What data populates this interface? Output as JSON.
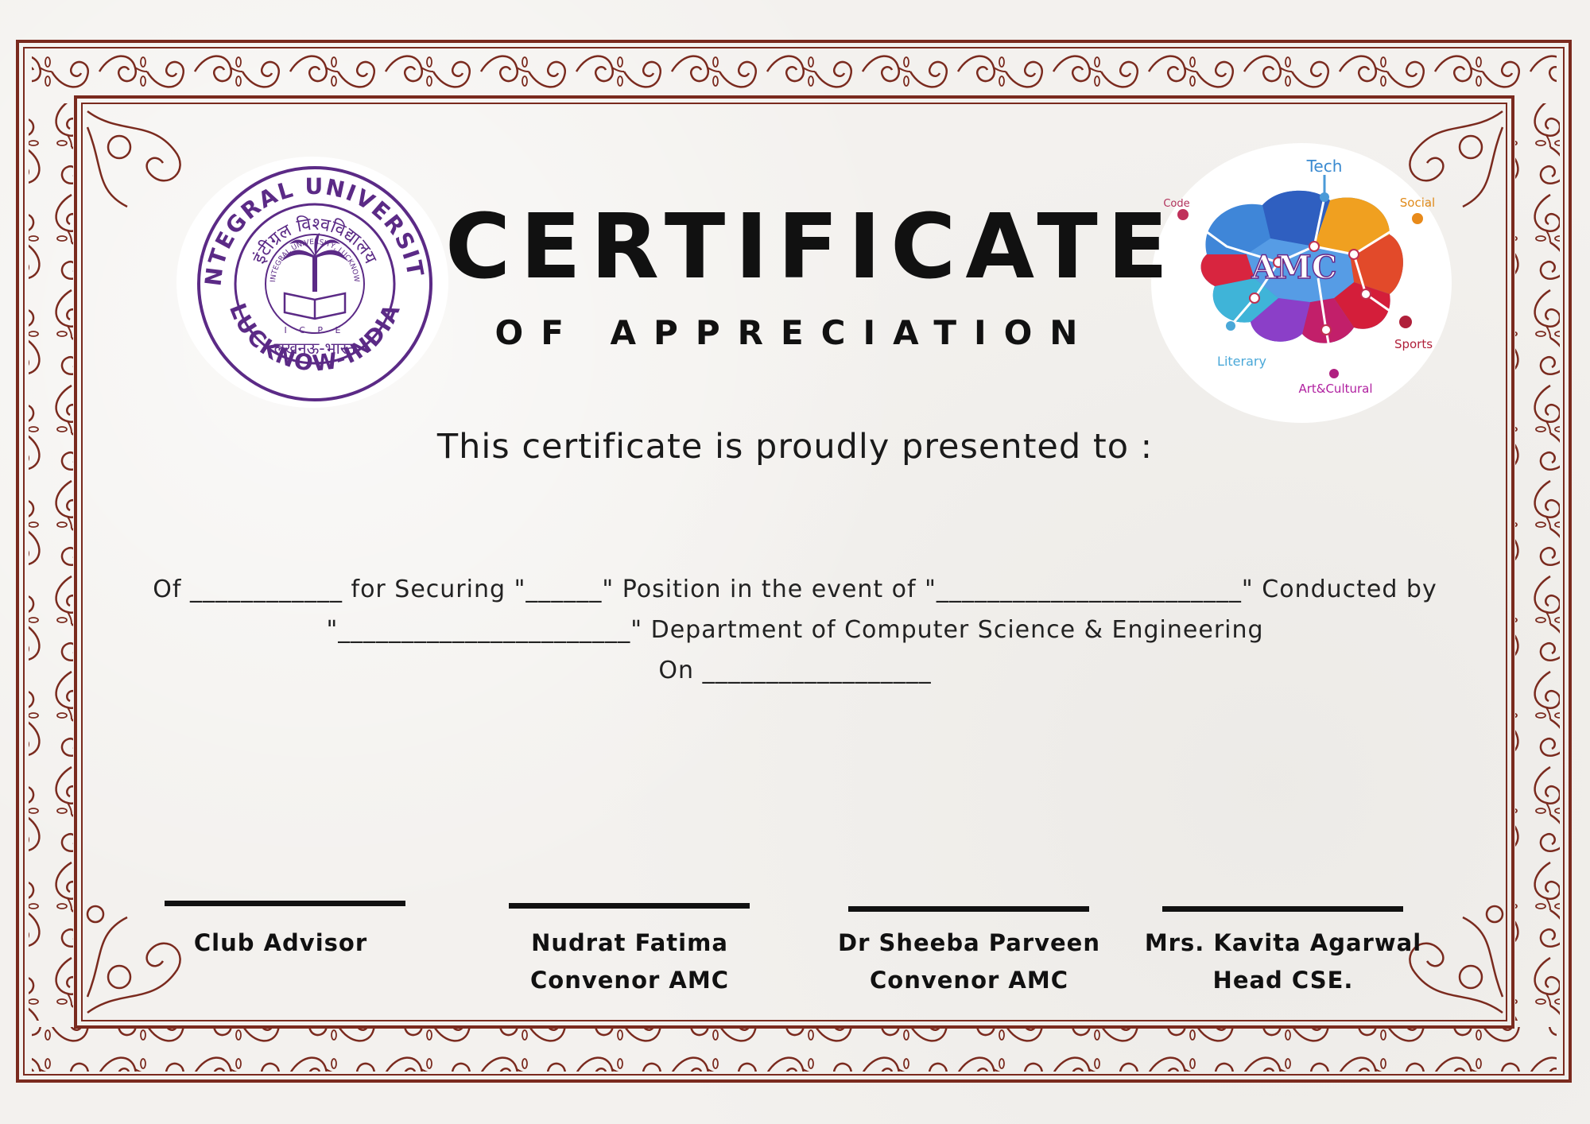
{
  "colors": {
    "border": "#7a2a1e",
    "seal_purple": "#5b2a86",
    "ink": "#111111"
  },
  "logos": {
    "left": {
      "name": "Integral University seal",
      "ring_top": "INTEGRAL UNIVERSITY",
      "ring_bottom": "LUCKNOW-INDIA",
      "hindi_top": "इंटीग्रल विश्वविद्यालय",
      "hindi_bottom": "लखनऊ-भारत",
      "inner_ring": "INTEGRAL UNIVERSITY, LUCKNOW",
      "inner_letters": "I C P E"
    },
    "right": {
      "name": "AMC club logo",
      "center": "AMC",
      "labels": [
        "Tech",
        "Social",
        "Code",
        "Sports",
        "Literary",
        "Art&Cultural"
      ]
    }
  },
  "certificate": {
    "title": "CERTIFICATE",
    "subtitle": "OF APPRECIATION",
    "presented": "This certificate is proudly presented to :",
    "line1": "Of ____________ for Securing \"______\" Position in the event of \"________________________\" Conducted by",
    "line2": "\"_______________________\" Department of Computer Science & Engineering",
    "line3": "On __________________"
  },
  "signatories": [
    {
      "name": "Club Advisor",
      "role": ""
    },
    {
      "name": "Nudrat Fatima",
      "role": "Convenor AMC"
    },
    {
      "name": "Dr Sheeba Parveen",
      "role": "Convenor AMC"
    },
    {
      "name": "Mrs. Kavita Agarwal",
      "role": "Head CSE."
    }
  ]
}
